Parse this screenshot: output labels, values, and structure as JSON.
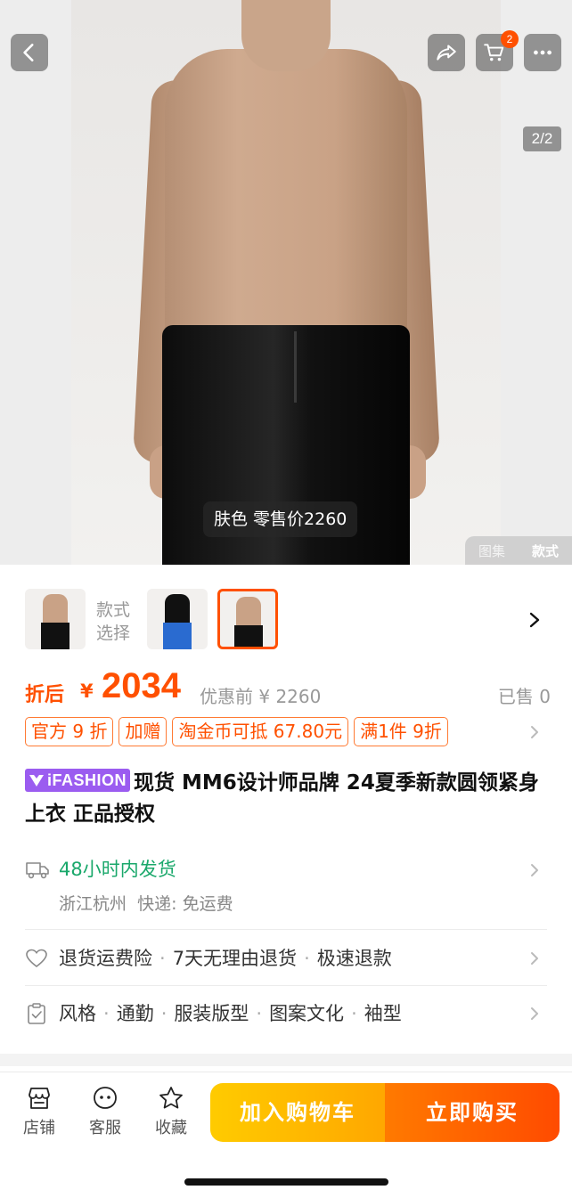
{
  "hero": {
    "page_indicator": "2/2",
    "caption": "肤色 零售价2260",
    "view_tabs": [
      "图集",
      "款式"
    ],
    "active_view_tab": "款式",
    "cart_count": "2"
  },
  "style_picker": {
    "label": "款式\n选择",
    "label_line1": "款式",
    "label_line2": "选择",
    "selected_index": 2
  },
  "price": {
    "after_label": "折后",
    "currency": "¥",
    "value": "2034",
    "original": "优惠前 ¥ 2260",
    "sold": "已售 0"
  },
  "tags": [
    "官方 9 折",
    "加赠",
    "淘金币可抵 67.80元",
    "满1件 9折"
  ],
  "title": {
    "badge": "iFASHION",
    "text": "现货 MM6设计师品牌 24夏季新款圆领紧身上衣 正品授权"
  },
  "delivery": {
    "ship_time": "48小时内发货",
    "origin": "浙江杭州",
    "express_label": "快递:",
    "express_fee": "免运费"
  },
  "services": [
    "退货运费险",
    "7天无理由退货",
    "极速退款"
  ],
  "params": [
    "风格",
    "通勤",
    "服装版型",
    "图案文化",
    "袖型"
  ],
  "bottom_nav": {
    "shop": "店铺",
    "service": "客服",
    "favorite": "收藏",
    "add_to_cart": "加入购物车",
    "buy_now": "立即购买"
  },
  "colors": {
    "accent": "#ff5000",
    "green": "#1aa86b",
    "ifashion_purple": "#9b5cf0",
    "cart_button": "#ffb300",
    "buy_button": "#ff5a00"
  }
}
